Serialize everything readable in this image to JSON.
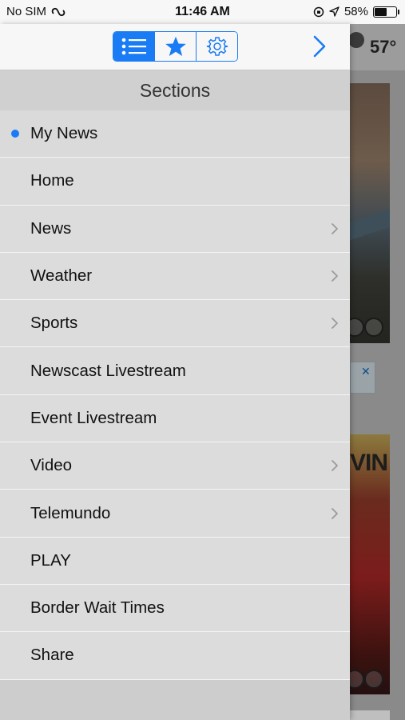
{
  "status_bar": {
    "carrier": "No SIM",
    "time": "11:46 AM",
    "battery_percent": "58%",
    "battery_level": 0.58
  },
  "toolbar": {
    "segments": [
      {
        "name": "sections",
        "icon": "list-icon",
        "active": true
      },
      {
        "name": "favorites",
        "icon": "star-icon",
        "active": false
      },
      {
        "name": "settings",
        "icon": "gear-icon",
        "active": false
      }
    ],
    "accent_color": "#1a7cf5"
  },
  "sections": {
    "title": "Sections",
    "items": [
      {
        "label": "My News",
        "selected": true,
        "has_children": false
      },
      {
        "label": "Home",
        "selected": false,
        "has_children": false
      },
      {
        "label": "News",
        "selected": false,
        "has_children": true
      },
      {
        "label": "Weather",
        "selected": false,
        "has_children": true
      },
      {
        "label": "Sports",
        "selected": false,
        "has_children": true
      },
      {
        "label": "Newscast Livestream",
        "selected": false,
        "has_children": false
      },
      {
        "label": "Event Livestream",
        "selected": false,
        "has_children": false
      },
      {
        "label": "Video",
        "selected": false,
        "has_children": true
      },
      {
        "label": "Telemundo",
        "selected": false,
        "has_children": true
      },
      {
        "label": "PLAY",
        "selected": false,
        "has_children": false
      },
      {
        "label": "Border Wait Times",
        "selected": false,
        "has_children": false
      },
      {
        "label": "Share",
        "selected": false,
        "has_children": false
      }
    ]
  },
  "background": {
    "temperature": "57°",
    "story_text": "VIN"
  }
}
